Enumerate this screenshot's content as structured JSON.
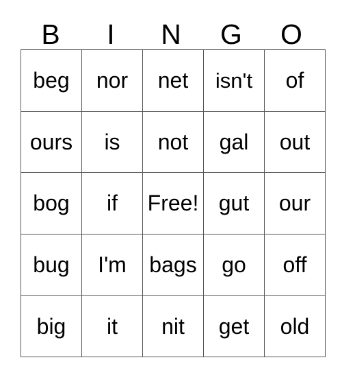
{
  "card": {
    "headers": [
      "B",
      "I",
      "N",
      "G",
      "O"
    ],
    "rows": [
      [
        "beg",
        "nor",
        "net",
        "isn't",
        "of"
      ],
      [
        "ours",
        "is",
        "not",
        "gal",
        "out"
      ],
      [
        "bog",
        "if",
        "Free!",
        "gut",
        "our"
      ],
      [
        "bug",
        "I'm",
        "bags",
        "go",
        "off"
      ],
      [
        "big",
        "it",
        "nit",
        "get",
        "old"
      ]
    ],
    "free_space": {
      "label": "Free!",
      "row": 2,
      "col": 2
    },
    "colors": {
      "background": "#ffffff",
      "text": "#000000",
      "grid_line": "#555555"
    }
  }
}
